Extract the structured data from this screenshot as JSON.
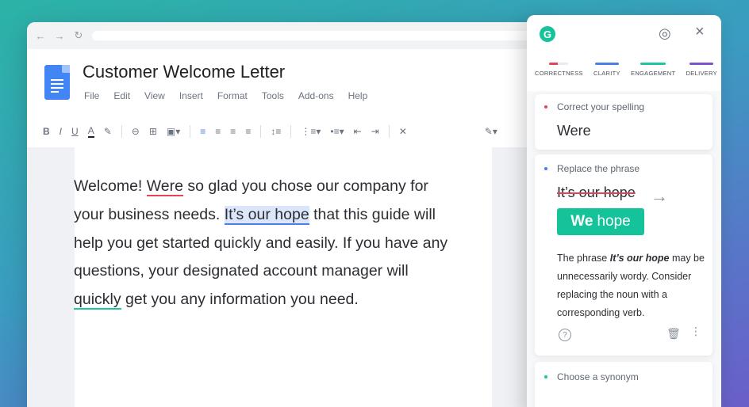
{
  "browser": {
    "nav": {
      "back": "←",
      "forward": "→",
      "reload": "↻"
    }
  },
  "doc": {
    "title": "Customer Welcome Letter",
    "menu": [
      "File",
      "Edit",
      "View",
      "Insert",
      "Format",
      "Tools",
      "Add-ons",
      "Help"
    ],
    "toolbar": {
      "bold": "B",
      "italic": "I",
      "underline": "U",
      "text_color": "A"
    },
    "text": {
      "s1": "Welcome! ",
      "w_were": "Were",
      "s2": " so glad you chose our company for your business needs. ",
      "w_hope": "It’s our hope",
      "s3": " that this guide will help you get started quickly and easily. If you have any questions, your designated account manager will ",
      "w_quickly": "quickly",
      "s4": " get you any information you need."
    }
  },
  "grammarly": {
    "logo": "G",
    "tabs": [
      {
        "label": "CORRECTNESS",
        "color": "#e2455a"
      },
      {
        "label": "CLARITY",
        "color": "#4a7ee8"
      },
      {
        "label": "ENGAGEMENT",
        "color": "#1fc4a0"
      },
      {
        "label": "DELIVERY",
        "color": "#7c53c8"
      }
    ],
    "card1": {
      "label": "Correct your spelling",
      "word": "Were"
    },
    "card2": {
      "label": "Replace the phrase",
      "original": "It’s our hope",
      "replacement_bold": "We",
      "replacement_rest": "hope",
      "explain_pre": "The phrase ",
      "explain_phrase": "It’s our hope",
      "explain_post": " may be unnecessarily wordy. Consider replacing the noun with a corresponding verb."
    },
    "card3": {
      "label": "Choose a synonym"
    },
    "colors": {
      "brand": "#15c39a",
      "correctness": "#e2455a",
      "clarity": "#4a7ee8",
      "engagement": "#1fc4a0"
    }
  }
}
